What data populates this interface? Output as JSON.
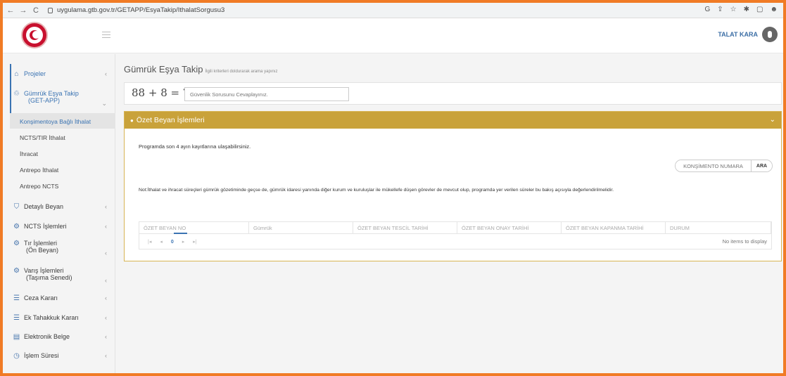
{
  "browser": {
    "back": "←",
    "forward": "→",
    "reload": "C",
    "url": "uygulama.gtb.gov.tr/GETAPP/EsyaTakip/IthalatSorgusu3",
    "icons": [
      "google-icon",
      "share-icon",
      "star-icon",
      "extensions-icon",
      "window-icon",
      "profile-icon"
    ]
  },
  "header": {
    "user_name": "TALAT KARA"
  },
  "sidebar": {
    "items": [
      {
        "label": "Projeler",
        "icon": "home-icon"
      },
      {
        "label": "Gümrük Eşya Takip",
        "label2": "(GET-APP)",
        "icon": "package-icon"
      },
      {
        "label": "Detaylı Beyan",
        "icon": "shield-icon"
      },
      {
        "label": "NCTS İşlemleri",
        "icon": "gear-icon"
      },
      {
        "label": "Tır İşlemleri",
        "label2": "(Ön Beyan)",
        "icon": "gear-icon"
      },
      {
        "label": "Varış İşlemleri",
        "label2": "(Taşıma Senedi)",
        "icon": "gear-icon"
      },
      {
        "label": "Ceza Kararı",
        "icon": "list-icon"
      },
      {
        "label": "Ek Tahakkuk Kararı",
        "icon": "list-icon"
      },
      {
        "label": "Elektronik Belge",
        "icon": "document-icon"
      },
      {
        "label": "İşlem Süresi",
        "icon": "clock-icon"
      }
    ],
    "sub_items": [
      "Konşimentoya Bağlı İthalat",
      "NCTS/TIR İthalat",
      "İhracat",
      "Antrepo İthalat",
      "Antrepo NCTS"
    ]
  },
  "main": {
    "title": "Gümrük Eşya Takip",
    "subtitle": "İlgili kriterleri doldurarak arama yapınız",
    "captcha": {
      "text": "88 + 8 = ?",
      "placeholder": "Güvenlik Sorusunu Cevaplayınız."
    },
    "panel": {
      "title": "Özet Beyan İşlemleri",
      "info": "Programda son 4 ayın kayıtlarına ulaşabilirsiniz.",
      "search_placeholder": "KONŞİMENTO NUMARA",
      "search_button": "ARA",
      "note": "Not:İthalat ve ihracat süreçleri gümrük gözetiminde geçse de, gümrük idaresi yanında diğer kurum ve kuruluşlar ile mükellefe düşen görevler de mevcut olup, programda yer verilen süreler bu bakış açısıyla değerlendirilmelidir.",
      "columns": [
        "ÖZET BEYAN NO",
        "Gümrük",
        "ÖZET BEYAN TESCİL TARİHİ",
        "ÖZET BEYAN ONAY TARİHİ",
        "ÖZET BEYAN KAPANMA TARİHİ",
        "DURUM"
      ],
      "pager": {
        "first": "|◂",
        "prev": "◂",
        "page": "0",
        "next": "▸",
        "last": "▸|"
      },
      "empty": "No items to display"
    }
  }
}
